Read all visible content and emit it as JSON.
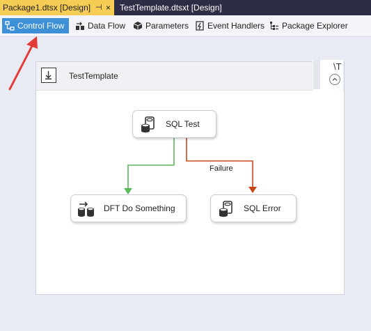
{
  "document_tabs": {
    "active": "Package1.dtsx [Design]",
    "pin_glyph": "⊣",
    "close_glyph": "×",
    "inactive": "TestTemplate.dtsxt [Design]"
  },
  "designer_tabs": [
    {
      "label": "Control Flow",
      "icon": "control-flow-icon",
      "selected": true
    },
    {
      "label": "Data Flow",
      "icon": "data-flow-icon",
      "selected": false
    },
    {
      "label": "Parameters",
      "icon": "parameters-icon",
      "selected": false
    },
    {
      "label": "Event Handlers",
      "icon": "event-handlers-icon",
      "selected": false
    },
    {
      "label": "Package Explorer",
      "icon": "package-explorer-icon",
      "selected": false
    }
  ],
  "container": {
    "title": "TestTemplate",
    "side_mark": "\\T"
  },
  "tasks": {
    "sql_test": "SQL Test",
    "dft": "DFT Do Something",
    "sql_error": "SQL Error"
  },
  "constraints": {
    "failure_label": "Failure"
  },
  "colors": {
    "success": "#5cb85c",
    "failure": "#c8471a",
    "annotation": "#e53935",
    "active_tab": "#f5cc54",
    "selected_designer_tab": "#3d8fd6"
  }
}
